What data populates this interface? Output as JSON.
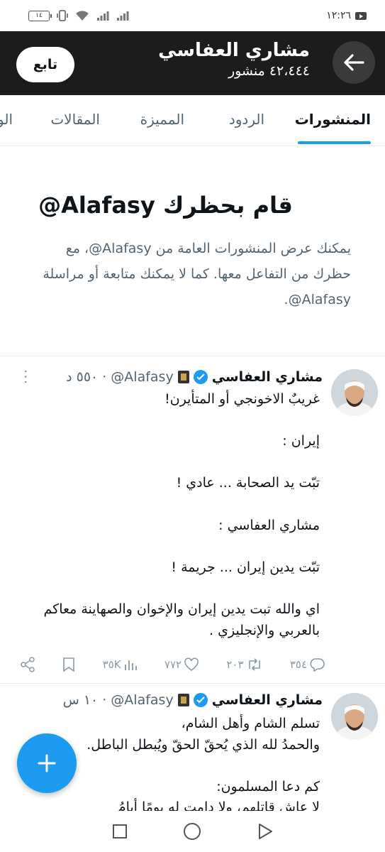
{
  "status_bar": {
    "time": "١٢:٢٦",
    "battery": "١٤"
  },
  "header": {
    "name": "مشاري العفاسي",
    "post_count": "٤٢،٤٤٤ منشور",
    "follow_label": "تابع"
  },
  "tabs": [
    {
      "label": "المنشورات",
      "active": true
    },
    {
      "label": "الردود",
      "active": false
    },
    {
      "label": "المميزة",
      "active": false
    },
    {
      "label": "المقالات",
      "active": false
    },
    {
      "label": "الو",
      "active": false
    }
  ],
  "blocked": {
    "title": "قام بحظرك Alafasy@",
    "body": "يمكنك عرض المنشورات العامة من Alafasy@، مع حظرك من التفاعل معها. كما لا يمكنك متابعة أو مراسلة Alafasy@."
  },
  "tweets": [
    {
      "author": "مشاري العفاسي",
      "handle": "Alafasy@",
      "time": "٥٥٠ د",
      "text": "غريبٌ الاخونجي أو المتأيرن!\n\nإيران :\n\nتبّت يد الصحابة ... عادي !\n\nمشاري العفاسي :\n\nتبّت يدين إيران ... جريمة !\n\nاي والله تبت يدين إيران والإخوان والصهاينة معاكم بالعربي والإنجليزي .",
      "replies": "٣٥٤",
      "reposts": "٢٠٣",
      "likes": "٧٧٢",
      "views": "٣٥K"
    },
    {
      "author": "مشاري العفاسي",
      "handle": "Alafasy@",
      "time": "١٠ س",
      "text": "تسلم الشام وأهل الشام،\nوالحمدُ لله الذي يُحقّ الحقّ ويُبطل الباطل.\n\nكم دعا المسلمون:\nلا عاش قاتلهم، ولا دامت له يومًا أيامُ"
    }
  ]
}
